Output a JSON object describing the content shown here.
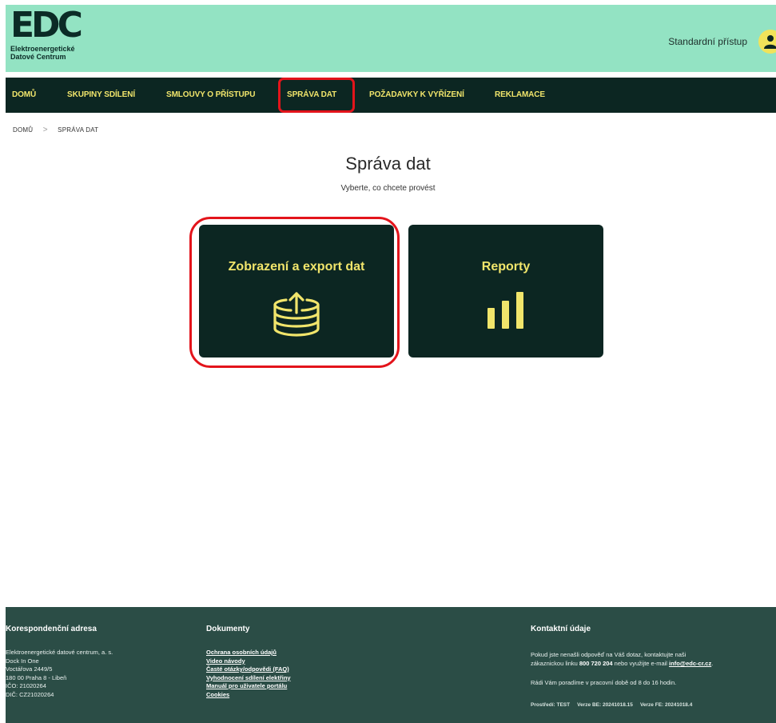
{
  "header": {
    "logo_mark": "EDC",
    "logo_line1": "Elektroenergetické",
    "logo_line2": "Datové Centrum",
    "access_label": "Standardní přístup"
  },
  "nav": {
    "items": [
      {
        "label": "DOMŮ"
      },
      {
        "label": "SKUPINY SDÍLENÍ"
      },
      {
        "label": "SMLOUVY O PŘÍSTUPU"
      },
      {
        "label": "SPRÁVA DAT"
      },
      {
        "label": "POŽADAVKY K VYŘÍZENÍ"
      },
      {
        "label": "REKLAMACE"
      }
    ],
    "active": "SPRÁVA DAT"
  },
  "breadcrumb": {
    "home": "DOMŮ",
    "separator": ">",
    "current": "SPRÁVA DAT"
  },
  "main": {
    "title": "Správa dat",
    "subtitle": "Vyberte, co chcete provést",
    "cards": [
      {
        "label": "Zobrazení a export dat",
        "icon": "database-export-icon"
      },
      {
        "label": "Reporty",
        "icon": "bar-chart-icon"
      }
    ]
  },
  "footer": {
    "address": {
      "heading": "Korespondenční adresa",
      "lines": [
        "Elektroenergetické datové centrum, a. s.",
        "Dock In One",
        "Voctářova 2449/5",
        "180 00 Praha 8 - Libeň",
        "IČO: 21020264",
        "DIČ: CZ21020264"
      ]
    },
    "documents": {
      "heading": "Dokumenty",
      "links": [
        "Ochrana osobních údajů",
        "Video návody",
        "Časté otázky/odpovědi (FAQ)",
        "Vyhodnocení sdílení elektřiny",
        "Manuál pro uživatele portálu",
        "Cookies"
      ]
    },
    "contact": {
      "heading": "Kontaktní údaje",
      "line1": "Pokud jste nenašli odpověď na Váš dotaz, kontaktujte naši",
      "line2_pre": "zákaznickou linku ",
      "phone": "800 720 204",
      "line2_mid": " nebo využijte e-mail ",
      "email": "info@edc-cr.cz",
      "line2_post": ".",
      "hours": "Rádi Vám poradíme v pracovní době od 8 do 16 hodin.",
      "env": "Prostředí: TEST",
      "be_version": "Verze BE: 20241018.15",
      "fe_version": "Verze FE: 20241018.4"
    }
  },
  "colors": {
    "header_bg": "#93e3c3",
    "nav_bg": "#0c2622",
    "accent_yellow": "#f1e56b",
    "highlight_red": "#e3141b",
    "footer_bg": "#2b4d46"
  }
}
